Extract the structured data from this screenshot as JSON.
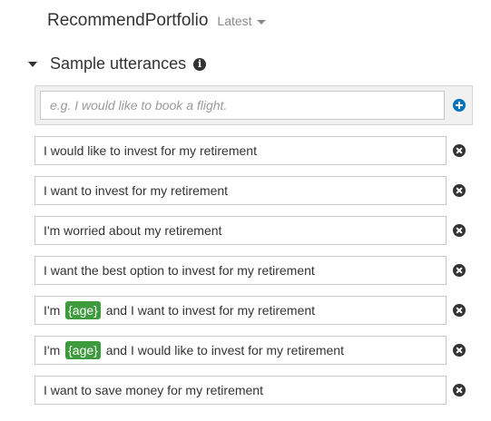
{
  "header": {
    "intent_name": "RecommendPortfolio",
    "version_label": "Latest"
  },
  "section": {
    "title": "Sample utterances",
    "info_icon": "info-icon"
  },
  "new_utterance": {
    "placeholder": "e.g. I would like to book a flight.",
    "value": "",
    "add_icon": "plus-circle-icon"
  },
  "utterances": [
    {
      "parts": [
        {
          "type": "text",
          "text": "I would like to invest for my retirement"
        }
      ]
    },
    {
      "parts": [
        {
          "type": "text",
          "text": "I want to invest for my retirement"
        }
      ]
    },
    {
      "parts": [
        {
          "type": "text",
          "text": "I'm worried about my retirement"
        }
      ]
    },
    {
      "parts": [
        {
          "type": "text",
          "text": "I want the best option to invest for my retirement"
        }
      ]
    },
    {
      "parts": [
        {
          "type": "text",
          "text": "I'm "
        },
        {
          "type": "slot",
          "text": "{age}"
        },
        {
          "type": "text",
          "text": " and I want to invest for my retirement"
        }
      ]
    },
    {
      "parts": [
        {
          "type": "text",
          "text": "I'm "
        },
        {
          "type": "slot",
          "text": "{age}"
        },
        {
          "type": "text",
          "text": " and I would like to invest for my retirement"
        }
      ]
    },
    {
      "parts": [
        {
          "type": "text",
          "text": "I want to save money for my retirement"
        }
      ]
    }
  ],
  "remove_icon": "remove-circle-icon",
  "colors": {
    "slot_background": "#3d9b3d",
    "add_icon": "#0073bb",
    "remove_icon": "#333333"
  }
}
